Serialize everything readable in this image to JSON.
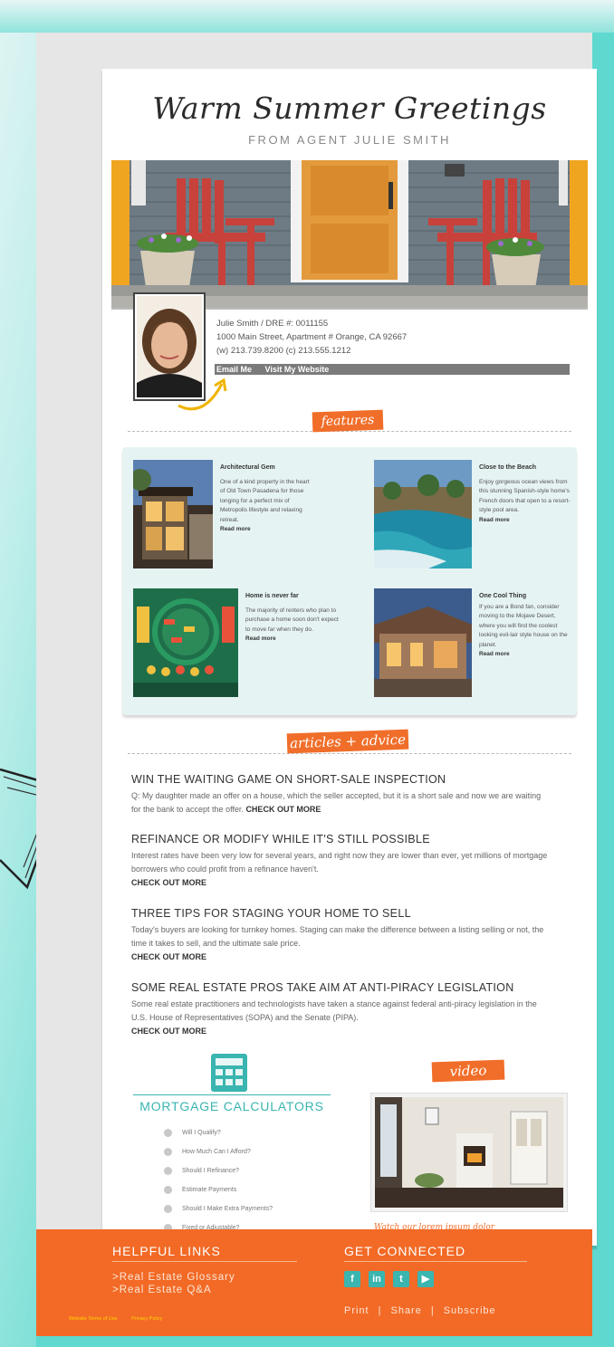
{
  "header": {
    "title": "Warm Summer Greetings",
    "subtitle": "FROM AGENT JULIE SMITH"
  },
  "agent": {
    "name_line": "Julie Smith / DRE #: 0011155",
    "address": "1000 Main Street, Apartment # Orange, CA 92667",
    "phones": "(w) 213.739.8200  (c) 213.555.1212",
    "email_label": "Email Me",
    "website_label": "Visit My Website"
  },
  "features": {
    "tag": "features",
    "items": [
      {
        "title": "Architectural Gem",
        "body": "One of a kind property in the heart of Old Town Pasadena for those longing for a perfect mix of Metropolis lifestyle and relaxing retreat.",
        "link": "Read more"
      },
      {
        "title": "Close to the Beach",
        "body": "Enjoy gorgeous ocean views from this stunning Spanish-style home's French doors that open to a resort-style pool area.",
        "link": "Read more"
      },
      {
        "title": "Home is never far",
        "body": "The majority of renters who plan to purchase a home soon don't expect to move far when they do.",
        "link": "Read more"
      },
      {
        "title": "One Cool Thing",
        "body": "If you are a Bond fan, consider moving to the Mojave Desert, where you will find the coolest looking evil-lair style house on the planet.",
        "link": "Read more"
      }
    ]
  },
  "articles": {
    "tag": "articles + advice",
    "items": [
      {
        "title": "WIN THE WAITING GAME ON SHORT-SALE INSPECTION",
        "body": "Q: My daughter made an offer on a house, which the seller accepted, but it is a short sale and now we are waiting for the bank to accept the offer.",
        "link": "CHECK OUT MORE"
      },
      {
        "title": "REFINANCE OR MODIFY WHILE IT'S STILL POSSIBLE",
        "body": "Interest rates have been very low for several years, and right now they are lower than ever, yet millions of mortgage borrowers who could profit from a refinance haven't.",
        "link": "CHECK OUT MORE"
      },
      {
        "title": "THREE TIPS FOR STAGING YOUR HOME TO SELL",
        "body": "Today's buyers are looking for turnkey homes. Staging can make the difference between a listing selling or not, the time it takes to sell, and the ultimate sale price.",
        "link": "CHECK OUT MORE"
      },
      {
        "title": "SOME REAL ESTATE PROS TAKE AIM AT ANTI-PIRACY LEGISLATION",
        "body": "Some real estate practitioners and technologists have taken a stance against federal anti-piracy legislation in the U.S. House of Representatives (SOPA) and the Senate (PIPA).",
        "link": "CHECK OUT MORE"
      }
    ]
  },
  "mortgage": {
    "title": "MORTGAGE CALCULATORS",
    "items": [
      "Will I Qualify?",
      "How Much Can I Afford?",
      "Should I Refinance?",
      "Estimate Payments",
      "Should I Make Extra Payments?",
      "Fixed or Adjustable?"
    ]
  },
  "video": {
    "tag": "video",
    "caption": "Watch our lorem ipsum dolor"
  },
  "footer": {
    "links_heading": "HELPFUL LINKS",
    "links": [
      ">Real Estate Glossary",
      ">Real Estate Q&A"
    ],
    "connect_heading": "GET CONNECTED",
    "social": [
      {
        "icon": "facebook-icon",
        "glyph": "f"
      },
      {
        "icon": "linkedin-icon",
        "glyph": "in"
      },
      {
        "icon": "twitter-icon",
        "glyph": "t"
      },
      {
        "icon": "youtube-icon",
        "glyph": "▶"
      }
    ],
    "actions": [
      "Print",
      "Share",
      "Subscribe"
    ],
    "legal": [
      "Website Terms of Use",
      "Privacy Policy"
    ]
  },
  "colors": {
    "accent_orange": "#f06e2a",
    "teal": "#3ab5b0",
    "background_teal": "#5fd9cf",
    "footer_orange": "#f26a26"
  }
}
